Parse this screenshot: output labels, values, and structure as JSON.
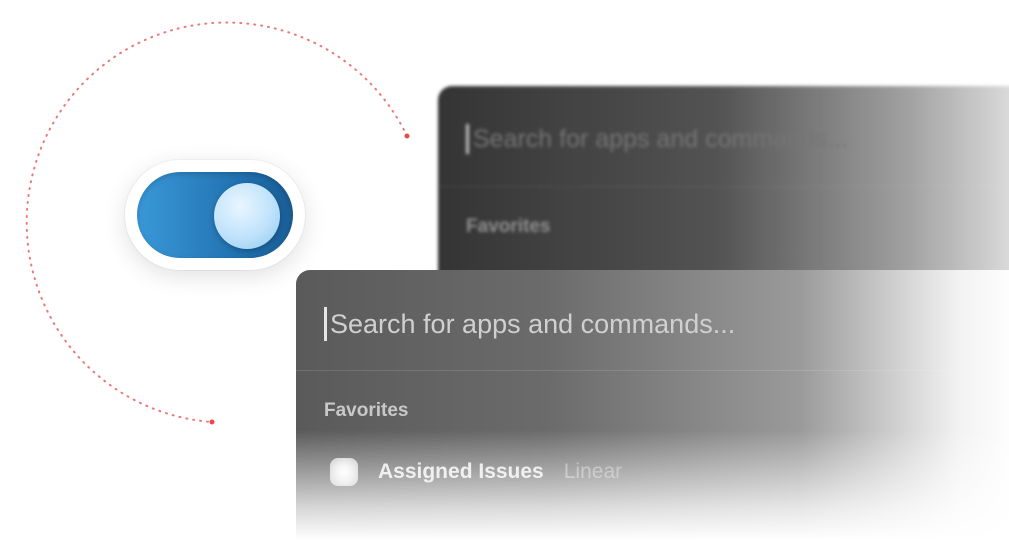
{
  "toggle": {
    "state": "on",
    "colors": {
      "track": "#2a82c4",
      "knob": "#cfe8fb"
    }
  },
  "back_panel": {
    "search_placeholder": "Search for apps and commands...",
    "section_label": "Favorites"
  },
  "front_panel": {
    "search_placeholder": "Search for apps and commands...",
    "section_label": "Favorites",
    "items": [
      {
        "title": "Assigned Issues",
        "subtitle": "Linear",
        "icon": "app-icon"
      }
    ]
  },
  "colors": {
    "orbit_dots": "#e84a4a",
    "background": "#ffffff"
  }
}
